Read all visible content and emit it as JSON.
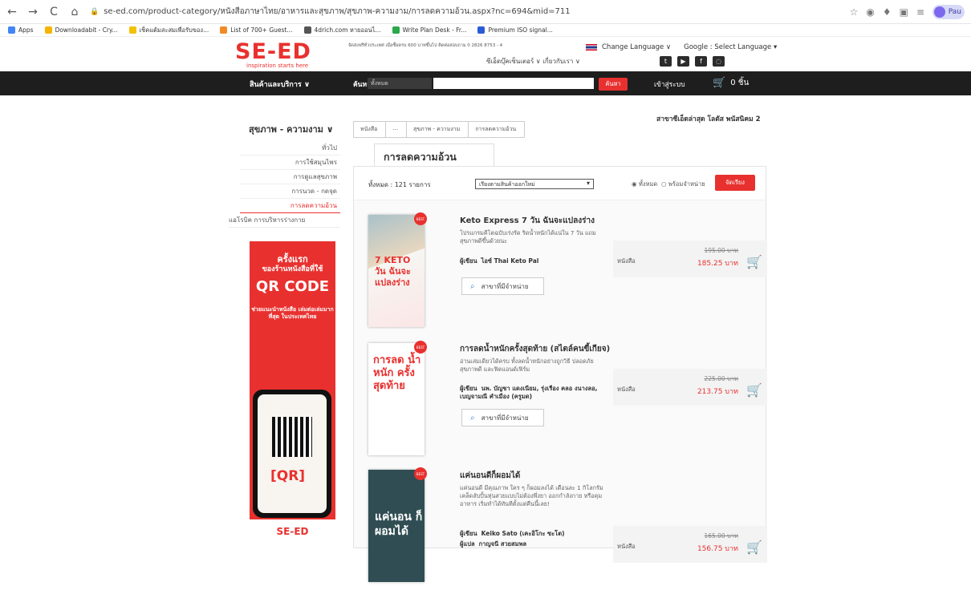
{
  "browser": {
    "url": "se-ed.com/product-category/หนังสือภาษาไทย/อาหารและสุขภาพ/สุขภาพ-ความงาม/การลดความอ้วน.aspx?nc=694&mid=711",
    "bookmarks": [
      "Apps",
      "Downloadabit - Cry...",
      "เช็คแต้มสะสมเพื่อรับของ...",
      "List of 700+ Guest...",
      "4drich.com หายออนไ...",
      "Write Plan Desk - Fr...",
      "Premium ISO signal..."
    ],
    "profile": "Pau"
  },
  "header": {
    "logo": "SE-ED",
    "tagline": "inspiration starts here",
    "promo": "จัดส่งฟรีทั่วประเทศ เมื่อซื้อครบ 600 บาทขึ้นไป  ติดต่อสอบถาม 0 2826 8753 - 4",
    "links": "ซีเอ็ดบุ๊คเซ็นเตอร์ ∨   เกี่ยวกับเรา ∨",
    "change_language": "Change Language ∨",
    "google_language": "Google : Select Language ▾",
    "colors": {
      "brand": "#e8312f",
      "nav": "#1e1e1e"
    }
  },
  "nav": {
    "products": "สินค้าและบริการ ∨",
    "search_label": "ค้นหา",
    "search_scope": "ทั้งหมด",
    "search_button": "ค้นหา",
    "login": "เข้าสู่ระบบ",
    "cart_count": "0 ชิ้น"
  },
  "branch_notice": "สาขาซีเอ็ดล่าสุด โลตัส พนัสนิคม 2",
  "sidebar": {
    "title": "สุขภาพ - ความงาม ∨",
    "items": [
      "ทั่วไป",
      "การใช้สมุนไพร",
      "การดูแลสุขภาพ",
      "การนวด - กดจุด",
      "การลดความอ้วน",
      "แอโรบิค การบริหารร่างกาย"
    ]
  },
  "banner": {
    "first": "ครั้งแรก",
    "store": "ของร้านหนังสือที่ใช้",
    "qr": "QR CODE",
    "sub": "ช่วยแนะนำหนังสือ เล่มต่อเล่มมากที่สุด ในประเทศไทย",
    "phone_label": "[QR]",
    "logo": "SE-ED"
  },
  "breadcrumb": [
    "หนังสือ",
    "...",
    "สุขภาพ - ความงาม",
    "การลดความอ้วน"
  ],
  "category_tab": "การลดความอ้วน",
  "toolbar": {
    "count": "ทั้งหมด : 121 รายการ",
    "sort": "เรียงตามสินค้าออกใหม่",
    "radio_all": "◉ ทั้งหมด",
    "radio_available": "○ พร้อมจำหน่าย",
    "sort_button": "จัดเรียง"
  },
  "products": [
    {
      "title": "Keto Express 7 วัน ฉันจะแปลงร่าง",
      "desc": "โปรแกรมคีโตฉบับเร่งรัด ริดน้ำหนักได้แน่ใน 7 วัน แถมสุขภาพดีขึ้นด้วยนะ",
      "author_label": "ผู้เขียน",
      "author": "ไอซ์ Thai Keto Pal",
      "type": "หนังสือ",
      "old_price": "195.00 บาท",
      "price": "185.25 บาท",
      "branch_btn": "สาขาที่มีจำหน่าย",
      "cover_text": "7 KETO วัน ฉันจะแปลงร่าง"
    },
    {
      "title": "การลดน้ำหนักครั้งสุดท้าย (สไตล์คนขี้เกียจ)",
      "desc": "อ่านเล่มเดียวได้ครบ ทั้งลดน้ำหนักอย่างถูกวิธี ปลอดภัย สุขภาพดี และฟิตแอนด์เฟิร์ม",
      "author_label": "ผู้เขียน",
      "author": "นพ. บัญชา แดงเนียม, รุ่งเรือง คลอ งนางลอ, เบญจามณี คำเมือง (ครูมด)",
      "type": "หนังสือ",
      "old_price": "225.00 บาท",
      "price": "213.75 บาท",
      "branch_btn": "สาขาที่มีจำหน่าย",
      "cover_text": "การลด น้ำหนัก ครั้งสุดท้าย"
    },
    {
      "title": "แค่นอนดีก็ผอมได้",
      "desc": "แค่นอนดี มีคุณภาพ ใคร ๆ ก็ผอมลงได้ เดือนละ 1 กิโลกรัม เคล็ดลับปั้นหุ่นสวยแบบไม่ต้องพึ่งยา ออกกำลังกาย หรือคุมอาหาร เริ่มทำได้ทันทีตั้งแต่คืนนี้เลย!",
      "author_label": "ผู้เขียน",
      "author": "Keiko Sato (เคะอิโกะ ซะโต)",
      "translator_label": "ผู้แปล",
      "translator": "กาญจนี สวยสมพล",
      "type": "หนังสือ",
      "old_price": "165.00 บาท",
      "price": "156.75 บาท",
      "cover_text": "แค่นอน ก็ผอมได้"
    }
  ]
}
